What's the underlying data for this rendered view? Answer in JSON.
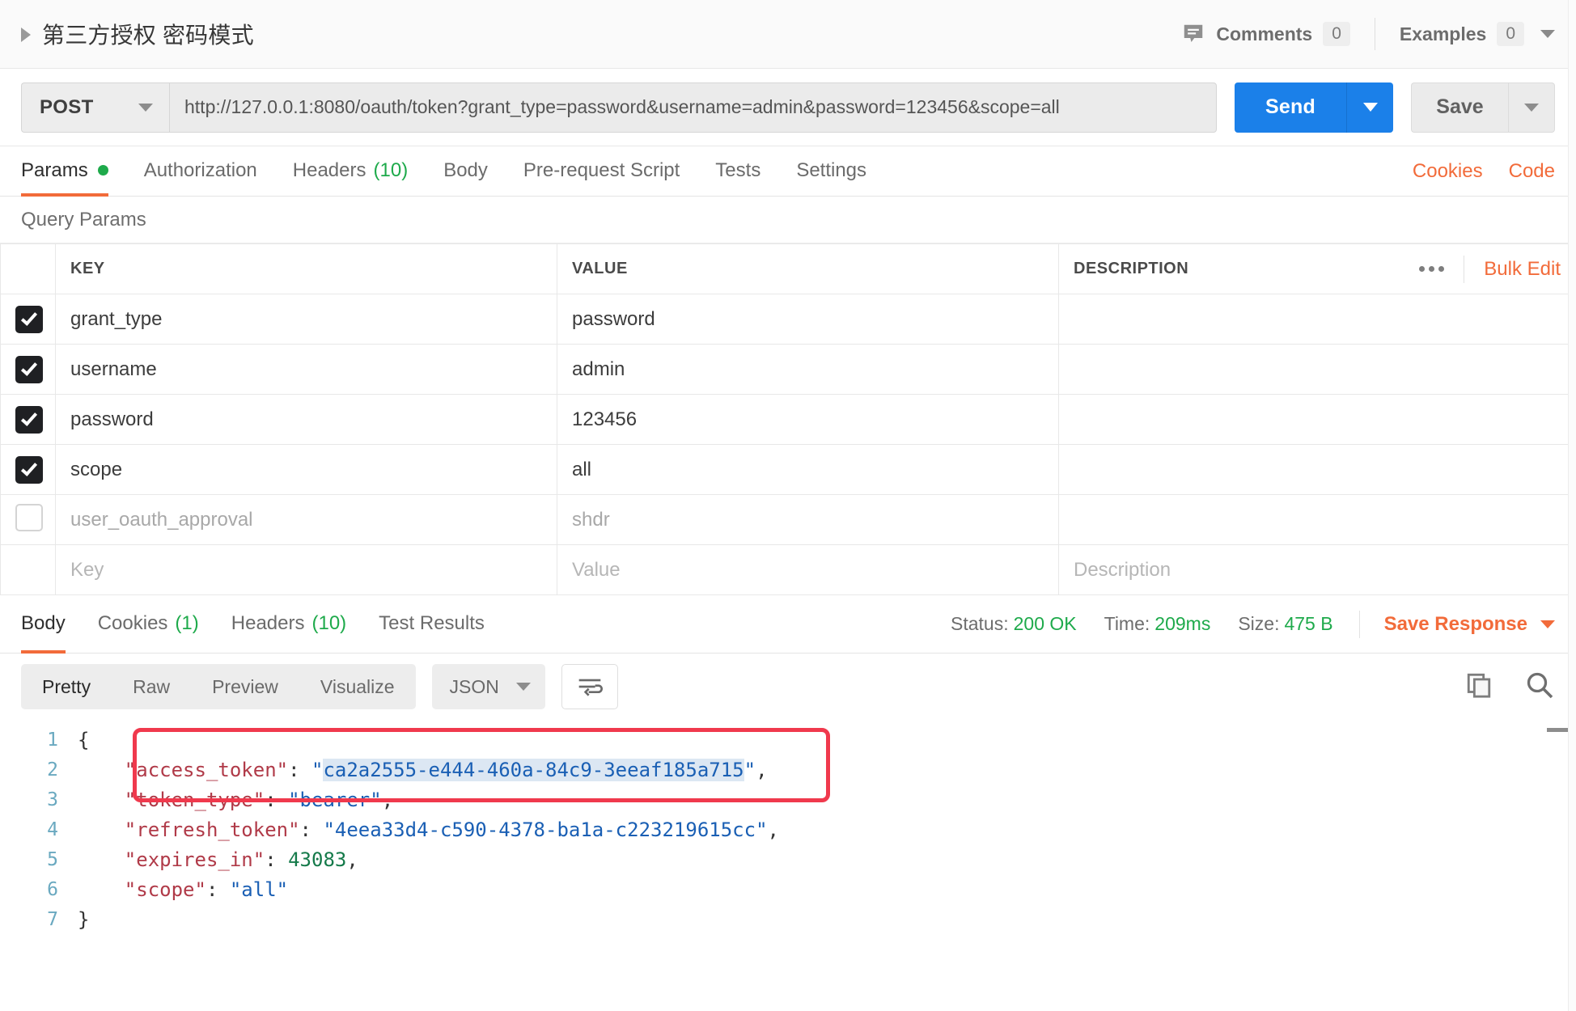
{
  "titlebar": {
    "request_title": "第三方授权 密码模式",
    "comments_label": "Comments",
    "comments_count": "0",
    "examples_label": "Examples",
    "examples_count": "0"
  },
  "urlbar": {
    "method": "POST",
    "url": "http://127.0.0.1:8080/oauth/token?grant_type=password&username=admin&password=123456&scope=all",
    "send_label": "Send",
    "save_label": "Save"
  },
  "request_tabs": {
    "items": [
      {
        "label": "Params",
        "dot": true
      },
      {
        "label": "Authorization"
      },
      {
        "label": "Headers",
        "count": "(10)"
      },
      {
        "label": "Body"
      },
      {
        "label": "Pre-request Script"
      },
      {
        "label": "Tests"
      },
      {
        "label": "Settings"
      }
    ],
    "cookies_link": "Cookies",
    "code_link": "Code",
    "accent_color": "#f26b3a"
  },
  "query_params": {
    "section_title": "Query Params",
    "headers": {
      "key": "KEY",
      "value": "VALUE",
      "description": "DESCRIPTION",
      "bulk_edit": "Bulk Edit"
    },
    "rows": [
      {
        "checked": true,
        "key": "grant_type",
        "value": "password",
        "description": ""
      },
      {
        "checked": true,
        "key": "username",
        "value": "admin",
        "description": ""
      },
      {
        "checked": true,
        "key": "password",
        "value": "123456",
        "description": ""
      },
      {
        "checked": true,
        "key": "scope",
        "value": "all",
        "description": ""
      },
      {
        "checked": false,
        "key": "user_oauth_approval",
        "value": "shdr",
        "description": ""
      }
    ],
    "new_row": {
      "key": "Key",
      "value": "Value",
      "description": "Description"
    }
  },
  "response": {
    "tabs": [
      {
        "label": "Body"
      },
      {
        "label": "Cookies",
        "count": "(1)"
      },
      {
        "label": "Headers",
        "count": "(10)"
      },
      {
        "label": "Test Results"
      }
    ],
    "status_label": "Status:",
    "status_value": "200 OK",
    "time_label": "Time:",
    "time_value": "209ms",
    "size_label": "Size:",
    "size_value": "475 B",
    "save_response": "Save Response",
    "view_modes": [
      "Pretty",
      "Raw",
      "Preview",
      "Visualize"
    ],
    "format": "JSON",
    "body_lines": [
      {
        "num": "1",
        "parts": [
          {
            "t": "{",
            "c": "p"
          }
        ]
      },
      {
        "num": "2",
        "parts": [
          {
            "t": "    ",
            "c": "p"
          },
          {
            "t": "\"access_token\"",
            "c": "k"
          },
          {
            "t": ": ",
            "c": "p"
          },
          {
            "t": "\"",
            "c": "s"
          },
          {
            "t": "ca2a2555-e444-460a-84c9-3eeaf185a715",
            "c": "s hl"
          },
          {
            "t": "\"",
            "c": "s"
          },
          {
            "t": ",",
            "c": "p"
          }
        ]
      },
      {
        "num": "3",
        "parts": [
          {
            "t": "    ",
            "c": "p"
          },
          {
            "t": "\"token_type\"",
            "c": "k"
          },
          {
            "t": ": ",
            "c": "p"
          },
          {
            "t": "\"bearer\"",
            "c": "s"
          },
          {
            "t": ",",
            "c": "p"
          }
        ]
      },
      {
        "num": "4",
        "parts": [
          {
            "t": "    ",
            "c": "p"
          },
          {
            "t": "\"refresh_token\"",
            "c": "k"
          },
          {
            "t": ": ",
            "c": "p"
          },
          {
            "t": "\"4eea33d4-c590-4378-ba1a-c223219615cc\"",
            "c": "s"
          },
          {
            "t": ",",
            "c": "p"
          }
        ]
      },
      {
        "num": "5",
        "parts": [
          {
            "t": "    ",
            "c": "p"
          },
          {
            "t": "\"expires_in\"",
            "c": "k"
          },
          {
            "t": ": ",
            "c": "p"
          },
          {
            "t": "43083",
            "c": "n"
          },
          {
            "t": ",",
            "c": "p"
          }
        ]
      },
      {
        "num": "6",
        "parts": [
          {
            "t": "    ",
            "c": "p"
          },
          {
            "t": "\"scope\"",
            "c": "k"
          },
          {
            "t": ": ",
            "c": "p"
          },
          {
            "t": "\"all\"",
            "c": "s"
          }
        ]
      },
      {
        "num": "7",
        "parts": [
          {
            "t": "}",
            "c": "p"
          }
        ]
      }
    ]
  }
}
